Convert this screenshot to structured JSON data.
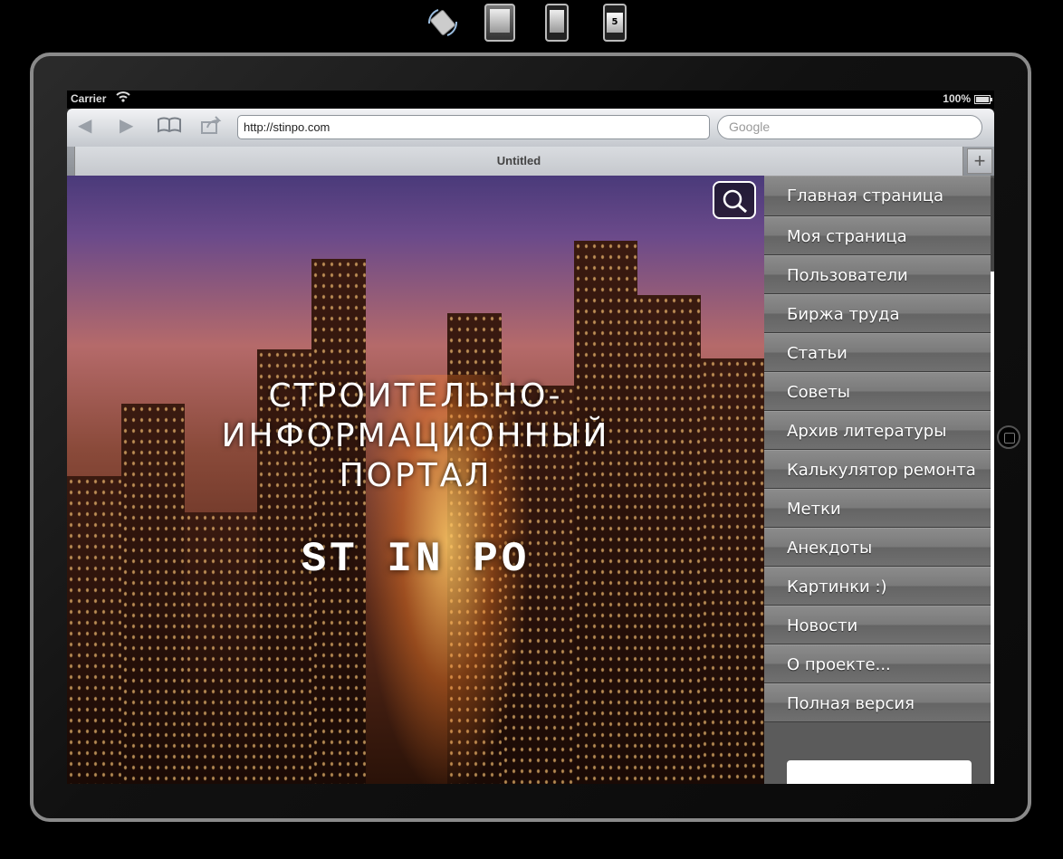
{
  "device_bar": {
    "rotate_icon": "rotate-device-icon",
    "ipad_icon": "ipad-icon",
    "iphone_icon": "iphone-icon",
    "iphone5_label": "5"
  },
  "statusbar": {
    "carrier": "Carrier",
    "battery": "100%"
  },
  "browser": {
    "url": "http://stinpo.com",
    "search_placeholder": "Google",
    "tab_title": "Untitled",
    "add_tab": "+"
  },
  "hero": {
    "title_lines": [
      "СТРОИТЕЛЬНО-",
      "ИНФОРМАЦИОННЫЙ",
      "ПОРТАЛ"
    ],
    "logo": "ST IN PO"
  },
  "menu": {
    "items": [
      "Главная страница",
      "Моя страница",
      "Пользователи",
      "Биржа труда",
      "Статьи",
      "Советы",
      "Архив литературы",
      "Калькулятор ремонта",
      "Метки",
      "Анекдоты",
      "Картинки :)",
      "Новости",
      "О проекте...",
      "Полная версия"
    ]
  }
}
